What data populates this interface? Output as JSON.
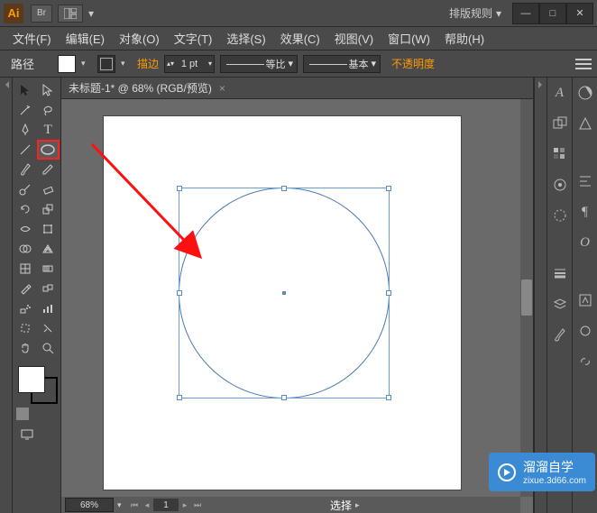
{
  "titlebar": {
    "app_code": "Ai",
    "br_label": "Br",
    "layout_rules": "排版规则"
  },
  "menu": {
    "file": "文件(F)",
    "edit": "编辑(E)",
    "object": "对象(O)",
    "type": "文字(T)",
    "select": "选择(S)",
    "effect": "效果(C)",
    "view": "视图(V)",
    "window": "窗口(W)",
    "help": "帮助(H)"
  },
  "control": {
    "path": "路径",
    "stroke": "描边",
    "stroke_value": "1 pt",
    "preset1": "等比",
    "preset2": "基本",
    "opacity": "不透明度"
  },
  "doc": {
    "tab_title": "未标题-1* @ 68% (RGB/预览)"
  },
  "status": {
    "zoom": "68%",
    "page": "1",
    "selection": "选择"
  },
  "icons": {
    "chev_down": "▾",
    "chev_right": "▸",
    "close": "×",
    "min": "—",
    "max": "□",
    "x": "✕"
  },
  "watermark": {
    "title": "溜溜自学",
    "sub": "zixue.3d66.com"
  }
}
